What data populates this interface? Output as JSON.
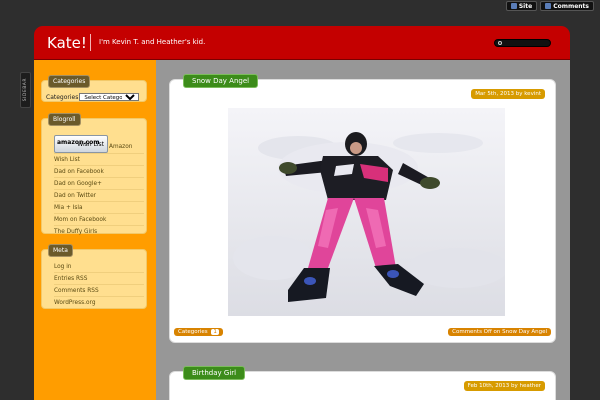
{
  "top_links": {
    "site_label": "Site",
    "comments_label": "Comments"
  },
  "sidebar_tab": {
    "label": "SIDEBAR"
  },
  "header": {
    "title": "Kate!",
    "tagline": "I'm Kevin T. and Heather's kid."
  },
  "widgets": {
    "categories": {
      "title": "Categories",
      "label": "Categories",
      "select_value": "Select Category"
    },
    "blogroll": {
      "title": "Blogroll",
      "amazon_badge_brand": "amazon.com",
      "amazon_badge_text": "Wish List",
      "amazon_label": "Amazon",
      "links": [
        "Wish List",
        "Dad on Facebook",
        "Dad on Google+",
        "Dad on Twitter",
        "Mia + Isla",
        "Mom on Facebook",
        "The Duffy Girls"
      ]
    },
    "meta": {
      "title": "Meta",
      "links": [
        "Log in",
        "Entries RSS",
        "Comments RSS",
        "WordPress.org"
      ]
    }
  },
  "posts": [
    {
      "title": "Snow Day Angel",
      "meta": "Mar 5th, 2013 by kevint",
      "categories_label": "Categories",
      "categories_count": "1",
      "comments_label": "Comments Off on Snow Day Angel"
    },
    {
      "title": "Birthday Girl",
      "meta": "Feb 10th, 2013 by heather"
    }
  ],
  "colors": {
    "header_red": "#c40000",
    "sidebar_orange": "#ff9d00",
    "post_title_green": "#3c8c1a",
    "badge_orange": "#d88300",
    "background": "#2e2e2e"
  }
}
